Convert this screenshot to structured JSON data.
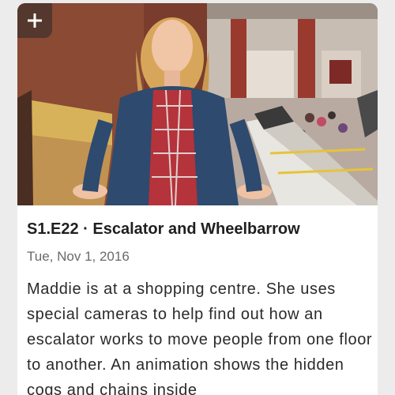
{
  "episode": {
    "title": "S1.E22 · Escalator and Wheelbarrow",
    "air_date": "Tue, Nov 1, 2016",
    "description": "Maddie is at a shopping centre. She uses special cameras to help find out how an escalator works to move people from one floor to another. An animation shows the hidden cogs and chains inside"
  },
  "thumbnail": {
    "subject": "presenter standing beside an escalator in a shopping centre"
  },
  "actions": {
    "add_icon": "plus-icon"
  },
  "colors": {
    "card_background": "#ffffff",
    "page_background": "#ececec",
    "title_text": "#1f1f1f",
    "date_text": "#6a6a6a"
  }
}
